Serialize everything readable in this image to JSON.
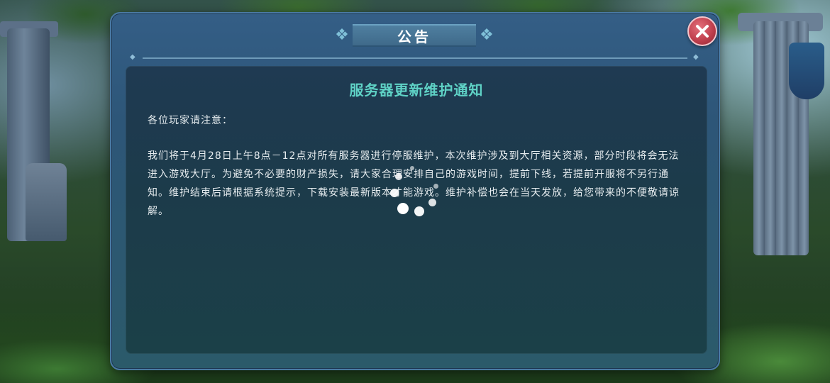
{
  "dialog": {
    "title": "公告",
    "close_icon": "close-x-icon"
  },
  "notice": {
    "heading": "服务器更新维护通知",
    "greeting": "各位玩家请注意：",
    "body": "我们将于4月28日上午8点－12点对所有服务器进行停服维护，本次维护涉及到大厅相关资源，部分时段将会无法进入游戏大厅。为避免不必要的财产损失，请大家合理安排自己的游戏时间，提前下线，若提前开服将不另行通知。维护结束后请根据系统提示，下载安装最新版本才能游戏。维护补偿也会在当天发放，给您带来的不便敬请谅解。"
  },
  "colors": {
    "heading": "#5fd2c6",
    "close_button": "#c0404e",
    "dialog_frame": "#345e86"
  },
  "overlay": {
    "loading_icon": "loading-spinner-icon"
  }
}
